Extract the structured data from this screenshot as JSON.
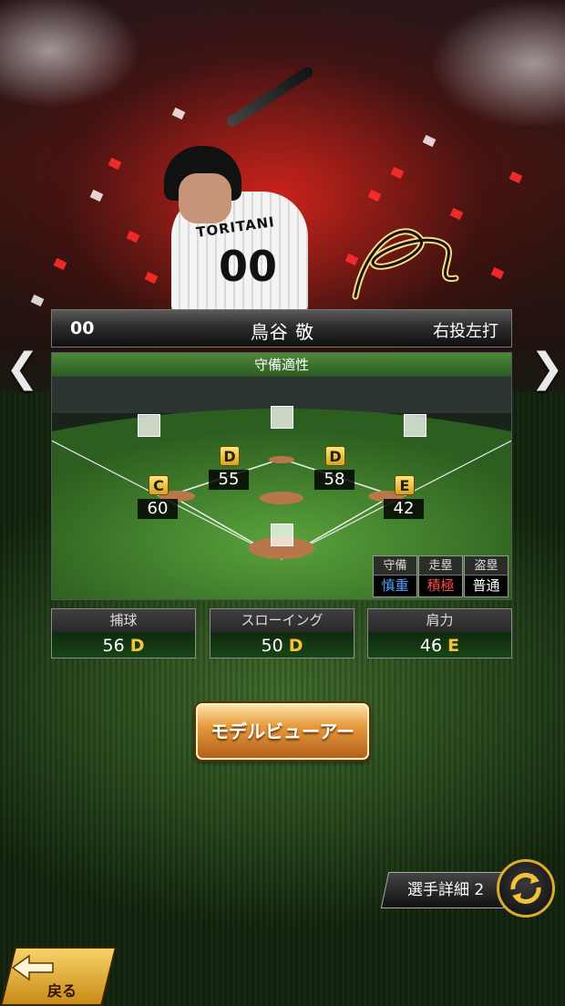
{
  "player": {
    "number": "00",
    "name": "鳥谷 敬",
    "throw_bat": "右投左打",
    "jersey_name": "TORITANI",
    "jersey_number": "00"
  },
  "nav": {
    "prev_icon": "chevron-left-icon",
    "next_icon": "chevron-right-icon",
    "prev_glyph": "❮",
    "next_glyph": "❯"
  },
  "defense": {
    "title": "守備適性",
    "positions": [
      {
        "id": "left-field",
        "grade": "",
        "value": ""
      },
      {
        "id": "center-field",
        "grade": "",
        "value": ""
      },
      {
        "id": "right-field",
        "grade": "",
        "value": ""
      },
      {
        "id": "shortstop",
        "grade": "D",
        "value": "55"
      },
      {
        "id": "second-base",
        "grade": "D",
        "value": "58"
      },
      {
        "id": "third-base",
        "grade": "C",
        "value": "60"
      },
      {
        "id": "first-base",
        "grade": "E",
        "value": "42"
      },
      {
        "id": "catcher",
        "grade": "",
        "value": ""
      }
    ],
    "traits": [
      {
        "label": "守備",
        "value": "慎重",
        "color": "#4da3ff"
      },
      {
        "label": "走塁",
        "value": "積極",
        "color": "#ff4a4a"
      },
      {
        "label": "盗塁",
        "value": "普通",
        "color": "#ffffff"
      }
    ]
  },
  "stats": [
    {
      "label": "捕球",
      "value": "56",
      "grade": "D"
    },
    {
      "label": "スローイング",
      "value": "50",
      "grade": "D"
    },
    {
      "label": "肩力",
      "value": "46",
      "grade": "E"
    }
  ],
  "buttons": {
    "model_viewer": "モデルビューアー",
    "player_detail": "選手詳細 2",
    "back": "戻る",
    "swap_icon": "swap-arrows-icon"
  },
  "colors": {
    "grade_gold": "#f4c336",
    "accent_red": "#ff2c2c"
  }
}
